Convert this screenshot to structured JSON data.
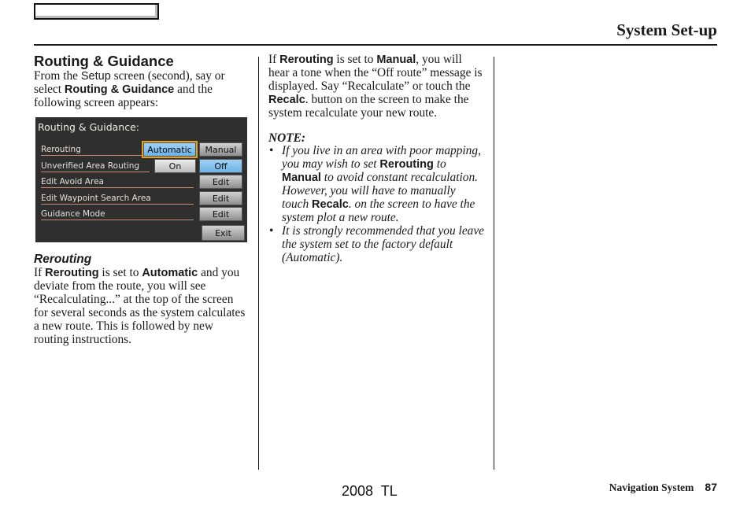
{
  "header": {
    "section_title": "System Set-up"
  },
  "left_column": {
    "heading": "Routing & Guidance",
    "intro": {
      "t1": "From the ",
      "setup": "Setup",
      "t2": " screen (second), say or select ",
      "routing_guidance": "Routing & Guidance",
      "t3": " and the following screen appears:"
    },
    "screen": {
      "title": "Routing & Guidance:",
      "rows": [
        {
          "label": "Rerouting",
          "options": [
            "Automatic",
            "Manual"
          ],
          "selected": "Automatic"
        },
        {
          "label": "Unverified Area Routing",
          "options": [
            "On",
            "Off"
          ],
          "selected": "Off"
        },
        {
          "label": "Edit Avoid Area",
          "options": [
            "Edit"
          ]
        },
        {
          "label": "Edit Waypoint Search Area",
          "options": [
            "Edit"
          ]
        },
        {
          "label": "Guidance Mode",
          "options": [
            "Edit"
          ]
        }
      ],
      "exit_label": "Exit",
      "colors": {
        "selected_button": "#6db3e8",
        "focus_border": "#e8a020",
        "background": "#2e2e2e"
      }
    },
    "subheading": "Rerouting",
    "rerouting_para": {
      "t1": "If ",
      "rerouting": "Rerouting",
      "t2": " is set to ",
      "automatic": "Automatic",
      "t3": " and you deviate from the route, you will see “Recalculating...” at the top of the screen for several seconds as the system calculates a new route. This is followed by new routing instructions."
    }
  },
  "right_column": {
    "manual_para": {
      "t1": "If ",
      "rerouting": "Rerouting",
      "t2": " is set to ",
      "manual": "Manual",
      "t3": ", you will hear a tone when the “Off route” message is displayed. Say “Recalculate” or touch the ",
      "recalc": "Recalc",
      "t4": ". button on the screen to make the system recalculate your new route."
    },
    "note_title": "NOTE:",
    "notes": [
      {
        "t1": "If you live in an area with poor mapping, you may wish to set ",
        "rerouting": "Rerouting",
        "t2": " to ",
        "manual": "Manual",
        "t3": " to avoid constant recalculation. However, you will have to manually touch ",
        "recalc": "Recalc",
        "t4": ". on the screen to have the system plot a new route."
      },
      {
        "t1": "It is strongly recommended that you leave the system set to the factory default (Automatic)."
      }
    ]
  },
  "footer": {
    "model": "2008  TL",
    "section": "Navigation System",
    "page_number": "87"
  }
}
